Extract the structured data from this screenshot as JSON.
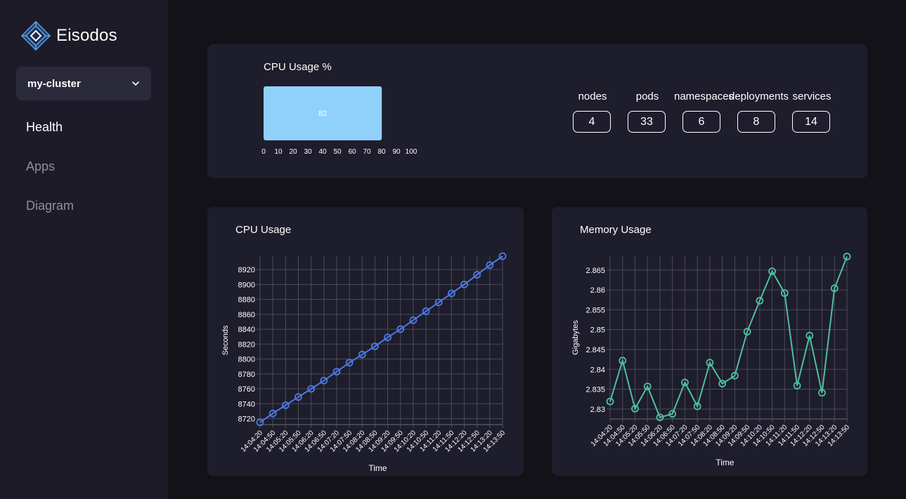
{
  "app": {
    "name": "Eisodos",
    "logo_icon": "eisodos-diamond-logo-icon"
  },
  "cluster_selector": {
    "value": "my-cluster",
    "icon": "chevron-down-icon"
  },
  "nav": [
    {
      "label": "Health",
      "active": true
    },
    {
      "label": "Apps",
      "active": false
    },
    {
      "label": "Diagram",
      "active": false
    }
  ],
  "cpu_gauge": {
    "title": "CPU Usage %",
    "value": 82,
    "value_label": "82",
    "max": 100,
    "ticks": [
      "0",
      "10",
      "20",
      "30",
      "40",
      "50",
      "60",
      "70",
      "80",
      "90",
      "100"
    ],
    "color": "#8fd1fb"
  },
  "stats": [
    {
      "label": "nodes",
      "value": "4"
    },
    {
      "label": "pods",
      "value": "33"
    },
    {
      "label": "namespaces",
      "value": "6"
    },
    {
      "label": "deployments",
      "value": "8"
    },
    {
      "label": "services",
      "value": "14"
    }
  ],
  "chart_data": [
    {
      "type": "line",
      "title": "CPU Usage",
      "xlabel": "Time",
      "ylabel": "Seconds",
      "x": [
        "14:04:20",
        "14:04:50",
        "14:05:20",
        "14:05:50",
        "14:06:20",
        "14:06:50",
        "14:07:20",
        "14:07:50",
        "14:08:20",
        "14:08:50",
        "14:09:20",
        "14:09:50",
        "14:10:20",
        "14:10:50",
        "14:11:20",
        "14:11:50",
        "14:12:20",
        "14:12:50",
        "14:13:20",
        "14:13:50"
      ],
      "series": [
        {
          "values": [
            8715,
            8727,
            8738,
            8749,
            8760,
            8771,
            8783,
            8795,
            8806,
            8817,
            8829,
            8840,
            8852,
            8864,
            8876,
            8888,
            8900,
            8913,
            8926,
            8938
          ],
          "color": "#4d79e8"
        }
      ],
      "yticks": [
        8720,
        8740,
        8760,
        8780,
        8800,
        8820,
        8840,
        8860,
        8880,
        8900,
        8920
      ],
      "ylim": [
        8712,
        8938
      ],
      "grid": true
    },
    {
      "type": "line",
      "title": "Memory Usage",
      "xlabel": "Time",
      "ylabel": "Gigabytes",
      "x": [
        "14:04:20",
        "14:04:50",
        "14:05:20",
        "14:05:50",
        "14:06:20",
        "14:06:50",
        "14:07:20",
        "14:07:50",
        "14:08:20",
        "14:08:50",
        "14:09:20",
        "14:09:50",
        "14:10:20",
        "14:10:50",
        "14:11:20",
        "14:11:50",
        "14:12:20",
        "14:12:50",
        "14:13:20",
        "14:13:50"
      ],
      "series": [
        {
          "values": [
            2.8319,
            2.8422,
            2.8301,
            2.8357,
            2.8279,
            2.8288,
            2.8367,
            2.8307,
            2.8417,
            2.8364,
            2.8384,
            2.8495,
            2.8573,
            2.8647,
            2.8592,
            2.8359,
            2.8485,
            2.8341,
            2.8604,
            2.8684
          ],
          "color": "#4fbfa0"
        }
      ],
      "yticks": [
        "2.83",
        "2.835",
        "2.84",
        "2.845",
        "2.85",
        "2.855",
        "2.86",
        "2.865"
      ],
      "ylim": [
        2.8275,
        2.8685
      ],
      "grid": true
    }
  ]
}
